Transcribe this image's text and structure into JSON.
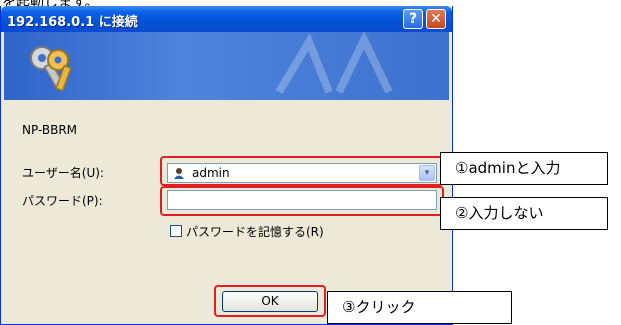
{
  "page": {
    "top_text": "を起動します。"
  },
  "dialog": {
    "title": "192.168.0.1 に接続",
    "help_symbol": "?",
    "close_symbol": "✕",
    "realm": "NP-BBRM",
    "username_label": "ユーザー名(U):",
    "username_value": "admin",
    "password_label": "パスワード(P):",
    "password_value": "",
    "remember_label": "パスワードを記憶する(R)",
    "remember_checked": false,
    "ok_label": "OK",
    "dropdown_symbol": "▾"
  },
  "annotations": {
    "step1": "①adminと入力",
    "step2": "②入力しない",
    "step3": "③クリック"
  },
  "colors": {
    "titlebar": "#0553d8",
    "highlight": "#e02020",
    "dialog_bg": "#ece9d8"
  },
  "icons": {
    "banner": "keys-icon",
    "user": "user-icon"
  }
}
